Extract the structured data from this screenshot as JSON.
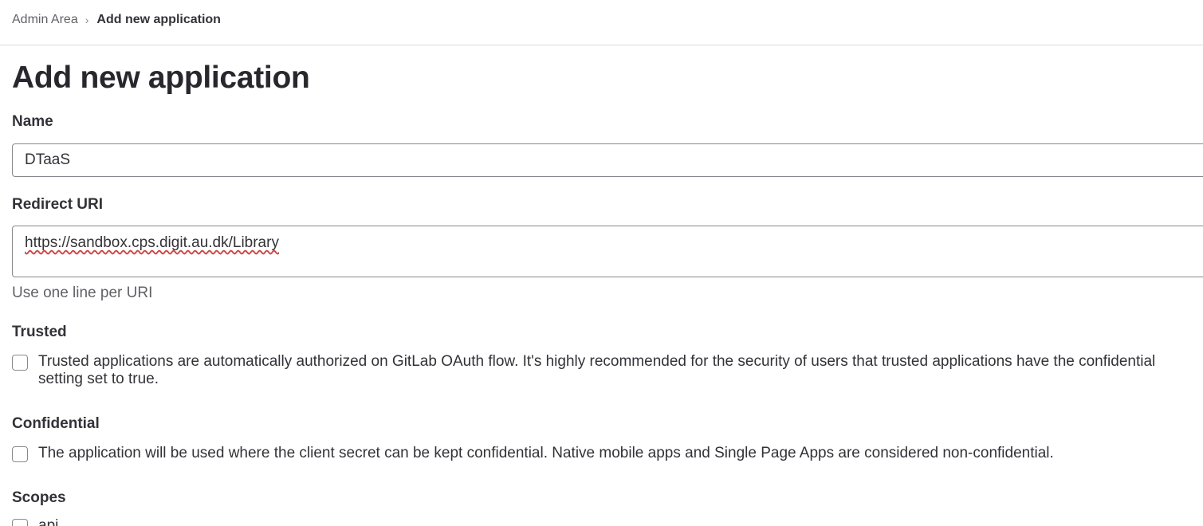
{
  "breadcrumb": {
    "parent": "Admin Area",
    "separator": "›",
    "current": "Add new application"
  },
  "page": {
    "title": "Add new application"
  },
  "form": {
    "name": {
      "label": "Name",
      "value": "DTaaS"
    },
    "redirect_uri": {
      "label": "Redirect URI",
      "value": "https://sandbox.cps.digit.au.dk/Library",
      "help": "Use one line per URI"
    },
    "trusted": {
      "label": "Trusted",
      "checked": false,
      "description": "Trusted applications are automatically authorized on GitLab OAuth flow. It's highly recommended for the security of users that trusted applications have the confidential setting set to true."
    },
    "confidential": {
      "label": "Confidential",
      "checked": false,
      "description": "The application will be used where the client secret can be kept confidential. Native mobile apps and Single Page Apps are considered non-confidential."
    },
    "scopes": {
      "label": "Scopes",
      "items": [
        {
          "label": "api",
          "checked": false
        }
      ]
    }
  }
}
